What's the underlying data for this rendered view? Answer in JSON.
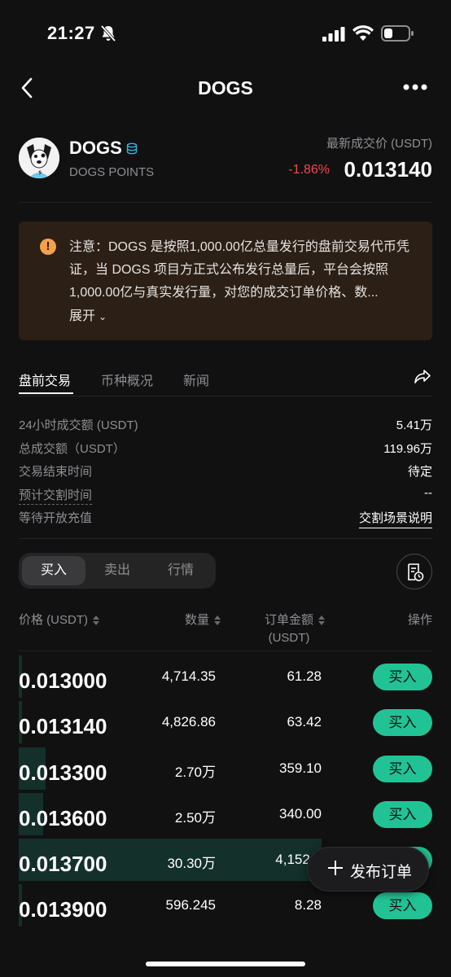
{
  "status_bar": {
    "time": "21:27"
  },
  "nav": {
    "title": "DOGS"
  },
  "token": {
    "name": "DOGS",
    "subtitle": "DOGS POINTS",
    "price_label": "最新成交价 (USDT)",
    "change": "-1.86%",
    "price": "0.013140"
  },
  "notice": {
    "icon": "!",
    "text": "注意：DOGS 是按照1,000.00亿总量发行的盘前交易代币凭证，当 DOGS 项目方正式公布发行总量后，平台会按照1,000.00亿与真实发行量，对您的成交订单价格、数...",
    "expand_label": "展开",
    "expand_icon": "chevron-down"
  },
  "tabs": [
    {
      "label": "盘前交易"
    },
    {
      "label": "币种概况"
    },
    {
      "label": "新闻"
    }
  ],
  "stats": [
    {
      "label": "24小时成交额 (USDT)",
      "value": "5.41万"
    },
    {
      "label": "总成交额（USDT）",
      "value": "119.96万"
    },
    {
      "label": "交易结束时间",
      "value": "待定"
    },
    {
      "label": "预计交割时间",
      "value": "--"
    },
    {
      "label": "等待开放充值",
      "value": "交割场景说明"
    }
  ],
  "segments": [
    {
      "label": "买入"
    },
    {
      "label": "卖出"
    },
    {
      "label": "行情"
    }
  ],
  "table": {
    "headers": {
      "price": "价格 (USDT)",
      "qty": "数量",
      "amount_line1": "订单金额",
      "amount_line2": "(USDT)",
      "action": "操作"
    },
    "buy_label": "买入",
    "rows": [
      {
        "price": "0.013000",
        "qty": "4,714.35",
        "amount": "61.28",
        "depth": 0.01
      },
      {
        "price": "0.013140",
        "qty": "4,826.86",
        "amount": "63.42",
        "depth": 0.01
      },
      {
        "price": "0.013300",
        "qty": "2.70万",
        "amount": "359.10",
        "depth": 0.09
      },
      {
        "price": "0.013600",
        "qty": "2.50万",
        "amount": "340.00",
        "depth": 0.08
      },
      {
        "price": "0.013700",
        "qty": "30.30万",
        "amount": "4,152.3",
        "depth": 1.0
      },
      {
        "price": "0.013900",
        "qty": "596.245",
        "amount": "8.28",
        "depth": 0.01
      }
    ]
  },
  "fab": {
    "label": "发布订单"
  },
  "colors": {
    "accent_green": "#21c395",
    "negative_red": "#f04848",
    "notice_bg": "#2b1f16",
    "warning_orange": "#f4a14a"
  }
}
